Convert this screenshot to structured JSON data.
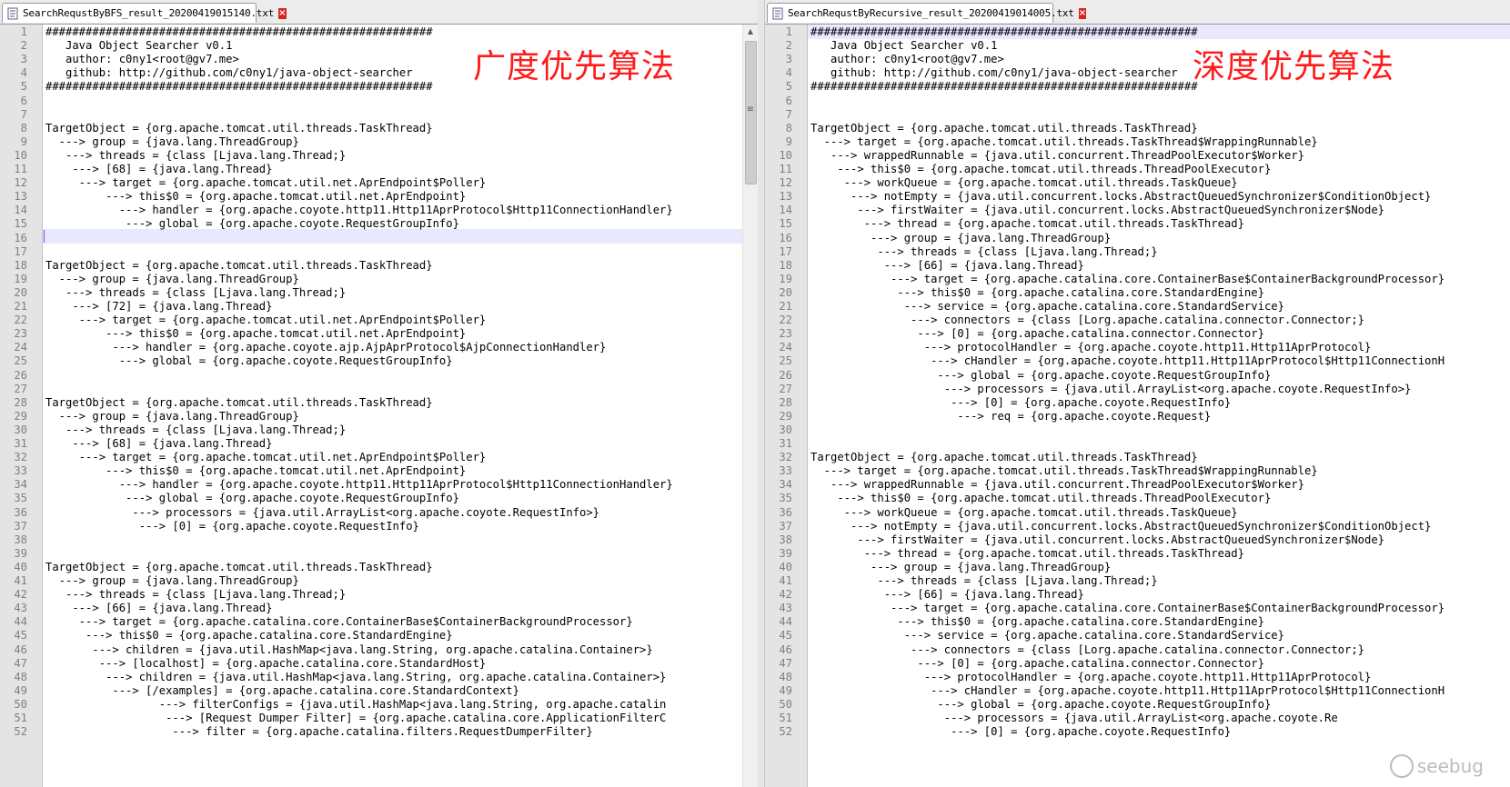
{
  "left": {
    "tab_title": "SearchRequstByBFS_result_20200419015140.txt",
    "overlay_title": "广度优先算法",
    "lines": [
      "##########################################################",
      "   Java Object Searcher v0.1",
      "   author: c0ny1<root@gv7.me>",
      "   github: http://github.com/c0ny1/java-object-searcher",
      "##########################################################",
      "",
      "",
      "TargetObject = {org.apache.tomcat.util.threads.TaskThread}",
      "  ---> group = {java.lang.ThreadGroup}",
      "   ---> threads = {class [Ljava.lang.Thread;}",
      "    ---> [68] = {java.lang.Thread}",
      "     ---> target = {org.apache.tomcat.util.net.AprEndpoint$Poller}",
      "         ---> this$0 = {org.apache.tomcat.util.net.AprEndpoint}",
      "           ---> handler = {org.apache.coyote.http11.Http11AprProtocol$Http11ConnectionHandler}",
      "            ---> global = {org.apache.coyote.RequestGroupInfo}",
      "",
      "",
      "TargetObject = {org.apache.tomcat.util.threads.TaskThread}",
      "  ---> group = {java.lang.ThreadGroup}",
      "   ---> threads = {class [Ljava.lang.Thread;}",
      "    ---> [72] = {java.lang.Thread}",
      "     ---> target = {org.apache.tomcat.util.net.AprEndpoint$Poller}",
      "         ---> this$0 = {org.apache.tomcat.util.net.AprEndpoint}",
      "          ---> handler = {org.apache.coyote.ajp.AjpAprProtocol$AjpConnectionHandler}",
      "           ---> global = {org.apache.coyote.RequestGroupInfo}",
      "",
      "",
      "TargetObject = {org.apache.tomcat.util.threads.TaskThread}",
      "  ---> group = {java.lang.ThreadGroup}",
      "   ---> threads = {class [Ljava.lang.Thread;}",
      "    ---> [68] = {java.lang.Thread}",
      "     ---> target = {org.apache.tomcat.util.net.AprEndpoint$Poller}",
      "         ---> this$0 = {org.apache.tomcat.util.net.AprEndpoint}",
      "           ---> handler = {org.apache.coyote.http11.Http11AprProtocol$Http11ConnectionHandler}",
      "            ---> global = {org.apache.coyote.RequestGroupInfo}",
      "             ---> processors = {java.util.ArrayList<org.apache.coyote.RequestInfo>}",
      "              ---> [0] = {org.apache.coyote.RequestInfo}",
      "",
      "",
      "TargetObject = {org.apache.tomcat.util.threads.TaskThread}",
      "  ---> group = {java.lang.ThreadGroup}",
      "   ---> threads = {class [Ljava.lang.Thread;}",
      "    ---> [66] = {java.lang.Thread}",
      "     ---> target = {org.apache.catalina.core.ContainerBase$ContainerBackgroundProcessor}",
      "      ---> this$0 = {org.apache.catalina.core.StandardEngine}",
      "       ---> children = {java.util.HashMap<java.lang.String, org.apache.catalina.Container>}",
      "        ---> [localhost] = {org.apache.catalina.core.StandardHost}",
      "         ---> children = {java.util.HashMap<java.lang.String, org.apache.catalina.Container>}",
      "          ---> [/examples] = {org.apache.catalina.core.StandardContext}",
      "                 ---> filterConfigs = {java.util.HashMap<java.lang.String, org.apache.catalin",
      "                  ---> [Request Dumper Filter] = {org.apache.catalina.core.ApplicationFilterC",
      "                   ---> filter = {org.apache.catalina.filters.RequestDumperFilter}"
    ]
  },
  "right": {
    "tab_title": "SearchRequstByRecursive_result_20200419014005.txt",
    "overlay_title": "深度优先算法",
    "lines": [
      "##########################################################",
      "   Java Object Searcher v0.1",
      "   author: c0ny1<root@gv7.me>",
      "   github: http://github.com/c0ny1/java-object-searcher",
      "##########################################################",
      "",
      "",
      "TargetObject = {org.apache.tomcat.util.threads.TaskThread}",
      "  ---> target = {org.apache.tomcat.util.threads.TaskThread$WrappingRunnable}",
      "   ---> wrappedRunnable = {java.util.concurrent.ThreadPoolExecutor$Worker}",
      "    ---> this$0 = {org.apache.tomcat.util.threads.ThreadPoolExecutor}",
      "     ---> workQueue = {org.apache.tomcat.util.threads.TaskQueue}",
      "      ---> notEmpty = {java.util.concurrent.locks.AbstractQueuedSynchronizer$ConditionObject}",
      "       ---> firstWaiter = {java.util.concurrent.locks.AbstractQueuedSynchronizer$Node}",
      "        ---> thread = {org.apache.tomcat.util.threads.TaskThread}",
      "         ---> group = {java.lang.ThreadGroup}",
      "          ---> threads = {class [Ljava.lang.Thread;}",
      "           ---> [66] = {java.lang.Thread}",
      "            ---> target = {org.apache.catalina.core.ContainerBase$ContainerBackgroundProcessor}",
      "             ---> this$0 = {org.apache.catalina.core.StandardEngine}",
      "              ---> service = {org.apache.catalina.core.StandardService}",
      "               ---> connectors = {class [Lorg.apache.catalina.connector.Connector;}",
      "                ---> [0] = {org.apache.catalina.connector.Connector}",
      "                 ---> protocolHandler = {org.apache.coyote.http11.Http11AprProtocol}",
      "                  ---> cHandler = {org.apache.coyote.http11.Http11AprProtocol$Http11ConnectionH",
      "                   ---> global = {org.apache.coyote.RequestGroupInfo}",
      "                    ---> processors = {java.util.ArrayList<org.apache.coyote.RequestInfo>}",
      "                     ---> [0] = {org.apache.coyote.RequestInfo}",
      "                      ---> req = {org.apache.coyote.Request}",
      "",
      "",
      "TargetObject = {org.apache.tomcat.util.threads.TaskThread}",
      "  ---> target = {org.apache.tomcat.util.threads.TaskThread$WrappingRunnable}",
      "   ---> wrappedRunnable = {java.util.concurrent.ThreadPoolExecutor$Worker}",
      "    ---> this$0 = {org.apache.tomcat.util.threads.ThreadPoolExecutor}",
      "     ---> workQueue = {org.apache.tomcat.util.threads.TaskQueue}",
      "      ---> notEmpty = {java.util.concurrent.locks.AbstractQueuedSynchronizer$ConditionObject}",
      "       ---> firstWaiter = {java.util.concurrent.locks.AbstractQueuedSynchronizer$Node}",
      "        ---> thread = {org.apache.tomcat.util.threads.TaskThread}",
      "         ---> group = {java.lang.ThreadGroup}",
      "          ---> threads = {class [Ljava.lang.Thread;}",
      "           ---> [66] = {java.lang.Thread}",
      "            ---> target = {org.apache.catalina.core.ContainerBase$ContainerBackgroundProcessor}",
      "             ---> this$0 = {org.apache.catalina.core.StandardEngine}",
      "              ---> service = {org.apache.catalina.core.StandardService}",
      "               ---> connectors = {class [Lorg.apache.catalina.connector.Connector;}",
      "                ---> [0] = {org.apache.catalina.connector.Connector}",
      "                 ---> protocolHandler = {org.apache.coyote.http11.Http11AprProtocol}",
      "                  ---> cHandler = {org.apache.coyote.http11.Http11AprProtocol$Http11ConnectionH",
      "                   ---> global = {org.apache.coyote.RequestGroupInfo}",
      "                    ---> processors = {java.util.ArrayList<org.apache.coyote.Re",
      "                     ---> [0] = {org.apache.coyote.RequestInfo}"
    ]
  },
  "colors": {
    "overlay_red": "#ff1a1a",
    "tab_close_red": "#d9251c",
    "current_line": "#e8e8ff",
    "gutter": "#e4e4e4"
  },
  "icons": {
    "file_icon": "notepad-file-icon",
    "close_icon": "close-x-icon",
    "scroll_up": "triangle-up-icon",
    "scroll_menu": "grip-icon"
  },
  "watermark_text": "seebug"
}
